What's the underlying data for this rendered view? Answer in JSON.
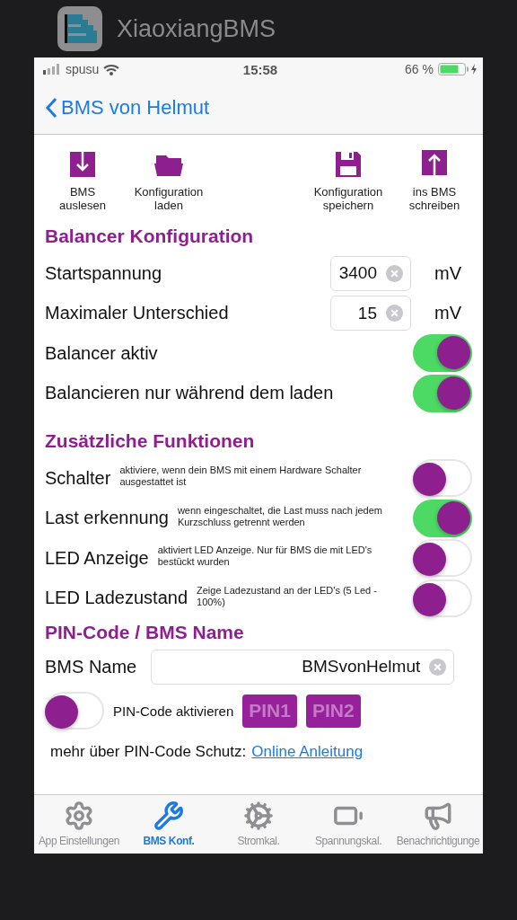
{
  "app_switcher": {
    "app_name": "XiaoxiangBMS"
  },
  "status_bar": {
    "carrier": "spusu",
    "time": "15:58",
    "battery": "66 %"
  },
  "nav": {
    "back": "BMS von Helmut"
  },
  "toolbar": {
    "left": [
      {
        "kind": "download",
        "label": "BMS\nauslesen"
      },
      {
        "kind": "folder",
        "label": "Konfiguration\nladen"
      }
    ],
    "right": [
      {
        "kind": "save",
        "label": "Konfiguration\nspeichern"
      },
      {
        "kind": "upload",
        "label": "ins BMS\nschreiben"
      }
    ]
  },
  "balancer": {
    "title": "Balancer Konfiguration",
    "rows": [
      {
        "kind": "input",
        "label": "Startspannung",
        "value": "3400",
        "unit": "mV"
      },
      {
        "kind": "input",
        "label": "Maximaler Unterschied",
        "value": "15",
        "unit": "mV"
      },
      {
        "kind": "toggle",
        "label": "Balancer aktiv",
        "on": true
      },
      {
        "kind": "toggle",
        "label": "Balancieren nur während dem laden",
        "on": true
      }
    ]
  },
  "functions": {
    "title": "Zusätzliche Funktionen",
    "rows": [
      {
        "label": "Schalter",
        "description": "aktiviere, wenn dein BMS mit einem Hardware Schalter ausgestattet ist",
        "on": false
      },
      {
        "label": "Last erkennung",
        "description": "wenn eingeschaltet, die Last muss nach jedem Kurzschluss getrennt werden",
        "on": true
      },
      {
        "label": "LED Anzeige",
        "description": "aktiviert LED Anzeige. Nur für BMS die mit LED's bestückt wurden",
        "on": false
      },
      {
        "label": "LED Ladezustand",
        "description": "Zeige Ladezustand an der LED's (5 Led - 100%)",
        "on": false
      }
    ]
  },
  "pin": {
    "title": "PIN-Code / BMS Name",
    "name_label": "BMS Name",
    "name_value": "BMSvonHelmut",
    "toggle": {
      "label": "PIN-Code aktivieren",
      "on": false
    },
    "buttons": [
      {
        "label": "PIN1",
        "disabled": true
      },
      {
        "label": "PIN2",
        "disabled": true
      }
    ],
    "info": "mehr über PIN-Code Schutz:",
    "link": "Online Anleitung"
  },
  "tabs": [
    {
      "kind": "gear",
      "label": "App Einstellungen",
      "selected": false
    },
    {
      "kind": "tools",
      "label": "BMS Konf.",
      "selected": true
    },
    {
      "kind": "gears",
      "label": "Stromkal.",
      "selected": false
    },
    {
      "kind": "battery",
      "label": "Spannungskal.",
      "selected": false
    },
    {
      "kind": "megaphone",
      "label": "Benachrichtigunge",
      "selected": false
    }
  ]
}
